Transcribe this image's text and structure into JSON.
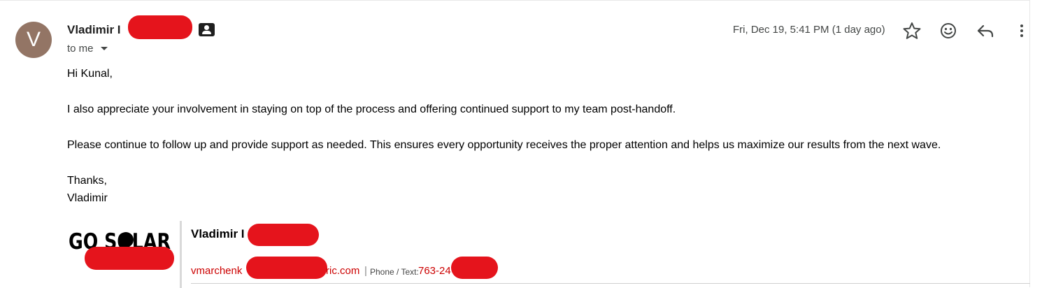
{
  "message": {
    "sender": {
      "initial": "V",
      "name": "Vladimir I",
      "avatar_color": "#937565"
    },
    "recipient_label": "to me",
    "date": "Fri, Dec 19, 5:41 PM (1 day ago)",
    "toolbar_icons": [
      "star-icon",
      "emoji-icon",
      "reply-icon",
      "more-vert-icon"
    ],
    "body": {
      "greeting": "Hi Kunal,",
      "paragraph_1": "I also appreciate your involvement in staying on top of the process and offering continued support to my team post-handoff.",
      "paragraph_2": "Please continue to follow up and provide support as needed. This ensures every opportunity receives the proper attention and helps us maximize our results from the next wave.",
      "closing": "Thanks,",
      "closing_name": "Vladimir"
    },
    "signature": {
      "logo_text": "GO SOLAR",
      "name": "Vladimir I",
      "email_start": "vmarchenk",
      "email_end": "ric.com",
      "separator": "|",
      "phone_label": "Phone / Text:",
      "phone": "763-24",
      "link_color": "#cc0000"
    },
    "redaction_color": "#e5141c"
  }
}
